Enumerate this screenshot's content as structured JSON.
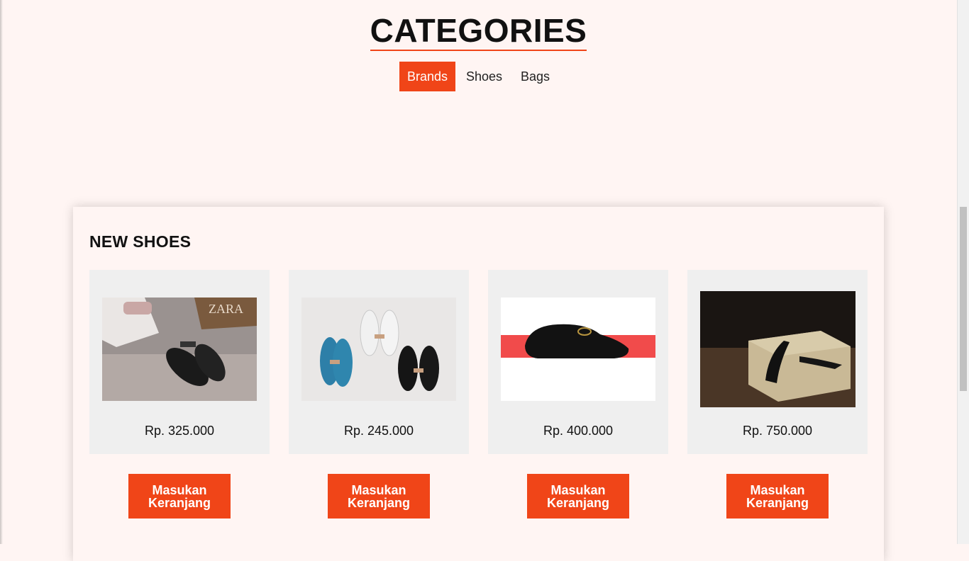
{
  "categories": {
    "title": "CATEGORIES",
    "tabs": [
      {
        "label": "Brands",
        "active": true
      },
      {
        "label": "Shoes",
        "active": false
      },
      {
        "label": "Bags",
        "active": false
      }
    ]
  },
  "new_shoes": {
    "heading": "NEW SHOES",
    "products": [
      {
        "price": "Rp. 325.000",
        "image": "black-slingback-flats-zara-photo",
        "button_label": "Masukan\nKeranjang"
      },
      {
        "price": "Rp. 245.000",
        "image": "three-pairs-kids-loafers-photo",
        "button_label": "Masukan\nKeranjang"
      },
      {
        "price": "Rp. 400.000",
        "image": "black-horsebit-loafer-photo",
        "button_label": "Masukan\nKeranjang"
      },
      {
        "price": "Rp. 750.000",
        "image": "black-slingback-heel-on-box-photo",
        "button_label": "Masukan\nKeranjang"
      }
    ]
  },
  "colors": {
    "accent": "#f04518",
    "background": "#fff5f3",
    "card": "#efefef"
  }
}
